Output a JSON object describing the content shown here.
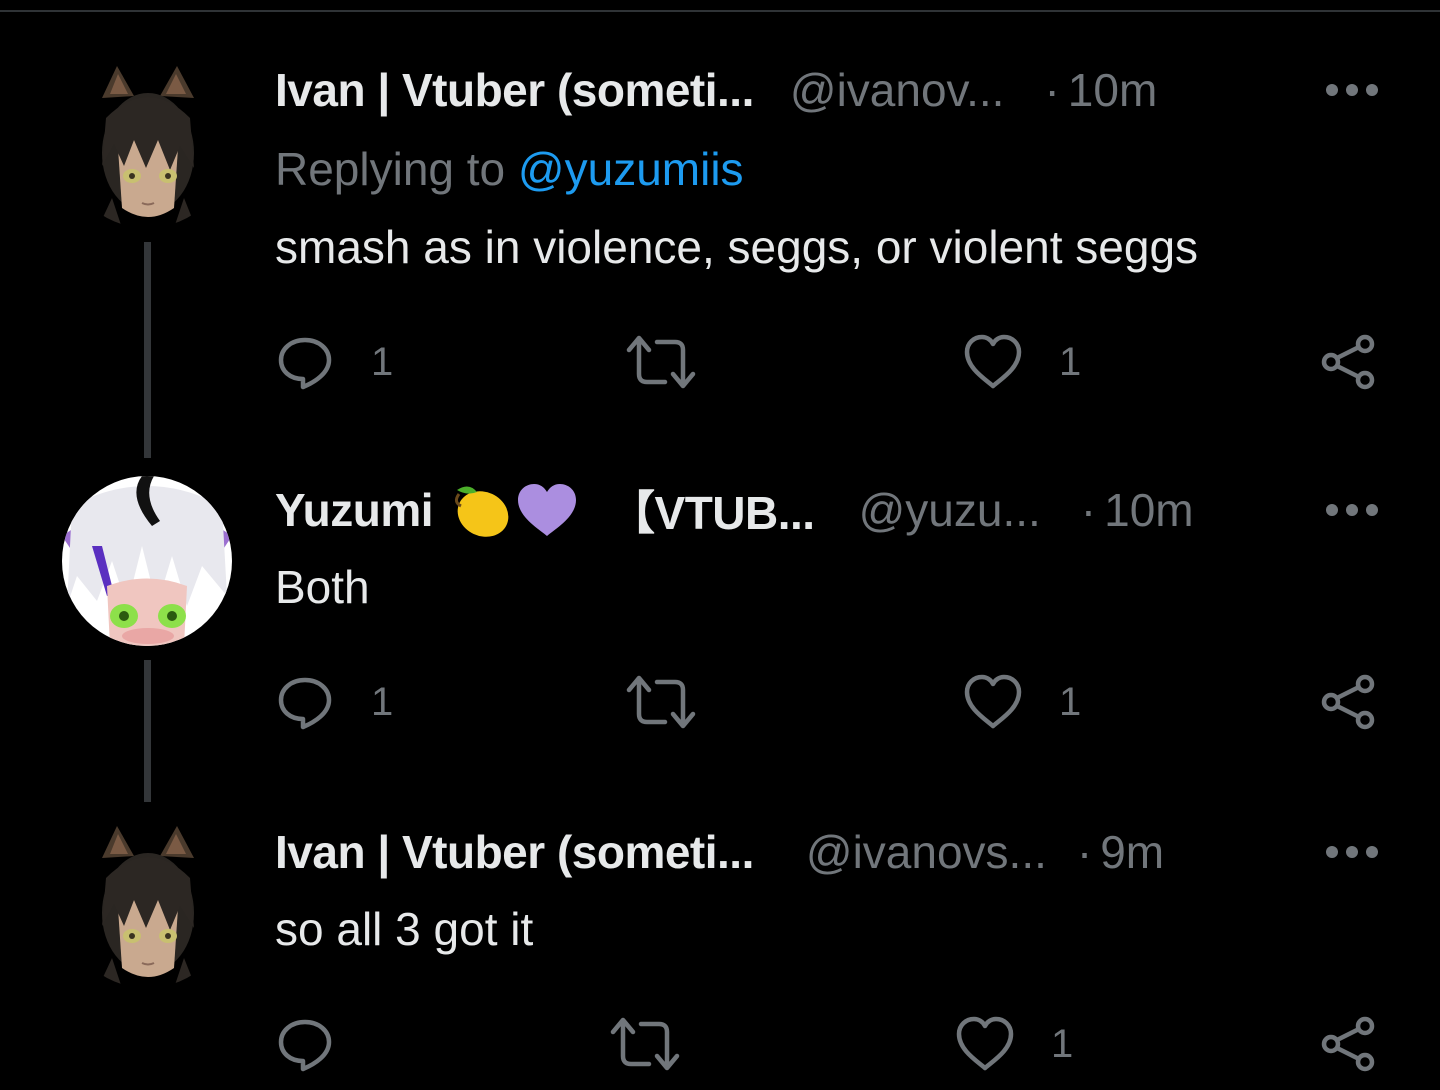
{
  "colors": {
    "background": "#000000",
    "text": "#e7e9ea",
    "muted": "#71767b",
    "link": "#1d9bf0",
    "thread_line": "#333639"
  },
  "tweets": [
    {
      "display_name": "Ivan | Vtuber (someti...",
      "handle": "@ivanov...",
      "dot": "·",
      "time": "10m",
      "replying_prefix": "Replying to ",
      "replying_to": "@yuzumiis",
      "text": "smash as in violence, seggs, or violent seggs",
      "reply_count": "1",
      "like_count": "1",
      "avatar": "ivan-avatar"
    },
    {
      "display_name": "Yuzumi",
      "name_emojis": [
        "lemon-emoji",
        "purple-heart-emoji"
      ],
      "display_name_suffix": "【VTUB...",
      "handle": "@yuzu...",
      "dot": "·",
      "time": "10m",
      "text": "Both",
      "reply_count": "1",
      "like_count": "1",
      "avatar": "yuzumi-avatar"
    },
    {
      "display_name": "Ivan | Vtuber (someti...",
      "handle": "@ivanovs...",
      "dot": "·",
      "time": "9m",
      "text": "so all 3 got it",
      "reply_count": "",
      "like_count": "1",
      "avatar": "ivan-avatar"
    }
  ],
  "icons": {
    "reply": "reply-icon",
    "retweet": "retweet-icon",
    "like": "heart-icon",
    "share": "share-icon",
    "more": "more-icon"
  }
}
